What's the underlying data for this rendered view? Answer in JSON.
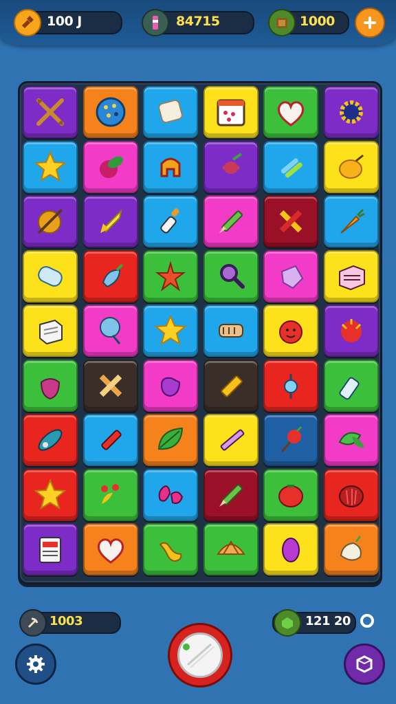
{
  "hud": {
    "left_value": "100 J",
    "center_value": "84715",
    "right_value": "1000"
  },
  "bottom": {
    "left_value": "1003",
    "right_value": "121 20"
  },
  "colors": {
    "purple": "#7e2cc7",
    "orange": "#f6821c",
    "blue": "#20a6ea",
    "yellow": "#fde21b",
    "green": "#3cc03b",
    "pink": "#f23bc6",
    "red": "#e8261f",
    "darkred": "#9a1027",
    "dark": "#3a2f28",
    "navy": "#1f5fa3"
  },
  "grid": [
    [
      {
        "c": "purple",
        "i": "crossed-arrows-icon"
      },
      {
        "c": "orange",
        "i": "cookie-icon"
      },
      {
        "c": "blue",
        "i": "marshmallow-icon"
      },
      {
        "c": "yellow",
        "i": "calendar-icon"
      },
      {
        "c": "green",
        "i": "heart-icon"
      },
      {
        "c": "purple",
        "i": "sun-gear-icon"
      }
    ],
    [
      {
        "c": "blue",
        "i": "star-icon"
      },
      {
        "c": "pink",
        "i": "leaf-berry-icon"
      },
      {
        "c": "blue",
        "i": "apple-bite-icon"
      },
      {
        "c": "purple",
        "i": "beet-icon"
      },
      {
        "c": "blue",
        "i": "crayons-icon"
      },
      {
        "c": "yellow",
        "i": "lemon-icon"
      }
    ],
    [
      {
        "c": "purple",
        "i": "yarn-ball-icon"
      },
      {
        "c": "purple",
        "i": "rocket-icon"
      },
      {
        "c": "blue",
        "i": "dropper-icon"
      },
      {
        "c": "pink",
        "i": "pencil-icon"
      },
      {
        "c": "darkred",
        "i": "cross-pencils-icon"
      },
      {
        "c": "blue",
        "i": "carrot-icon"
      }
    ],
    [
      {
        "c": "yellow",
        "i": "eraser-icon"
      },
      {
        "c": "red",
        "i": "radish-icon"
      },
      {
        "c": "green",
        "i": "starfish-icon"
      },
      {
        "c": "green",
        "i": "magnifier-icon"
      },
      {
        "c": "pink",
        "i": "crystal-icon"
      },
      {
        "c": "yellow",
        "i": "box-icon"
      }
    ],
    [
      {
        "c": "yellow",
        "i": "sugar-cube-icon"
      },
      {
        "c": "pink",
        "i": "balloon-icon"
      },
      {
        "c": "blue",
        "i": "star-icon"
      },
      {
        "c": "blue",
        "i": "cork-icon"
      },
      {
        "c": "yellow",
        "i": "tomato-face-icon"
      },
      {
        "c": "purple",
        "i": "dragonfruit-icon"
      }
    ],
    [
      {
        "c": "green",
        "i": "strawberry-icon"
      },
      {
        "c": "dark",
        "i": "crossed-sticks-icon"
      },
      {
        "c": "pink",
        "i": "pepper-icon"
      },
      {
        "c": "dark",
        "i": "marker-icon"
      },
      {
        "c": "red",
        "i": "candy-icon"
      },
      {
        "c": "green",
        "i": "bottle-icon"
      }
    ],
    [
      {
        "c": "red",
        "i": "nut-icon"
      },
      {
        "c": "blue",
        "i": "lipstick-icon"
      },
      {
        "c": "orange",
        "i": "leaf-icon"
      },
      {
        "c": "yellow",
        "i": "pen-icon"
      },
      {
        "c": "navy",
        "i": "cherry-icon"
      },
      {
        "c": "pink",
        "i": "leaves-icon"
      }
    ],
    [
      {
        "c": "red",
        "i": "star-icon"
      },
      {
        "c": "green",
        "i": "chili-icon"
      },
      {
        "c": "blue",
        "i": "petals-icon"
      },
      {
        "c": "darkred",
        "i": "pencil-icon"
      },
      {
        "c": "green",
        "i": "tomato-icon"
      },
      {
        "c": "red",
        "i": "pomegranate-icon"
      }
    ],
    [
      {
        "c": "purple",
        "i": "card-icon"
      },
      {
        "c": "orange",
        "i": "heart-icon"
      },
      {
        "c": "green",
        "i": "peanut-icon"
      },
      {
        "c": "green",
        "i": "shell-icon"
      },
      {
        "c": "yellow",
        "i": "plum-icon"
      },
      {
        "c": "orange",
        "i": "garlic-icon"
      }
    ]
  ]
}
